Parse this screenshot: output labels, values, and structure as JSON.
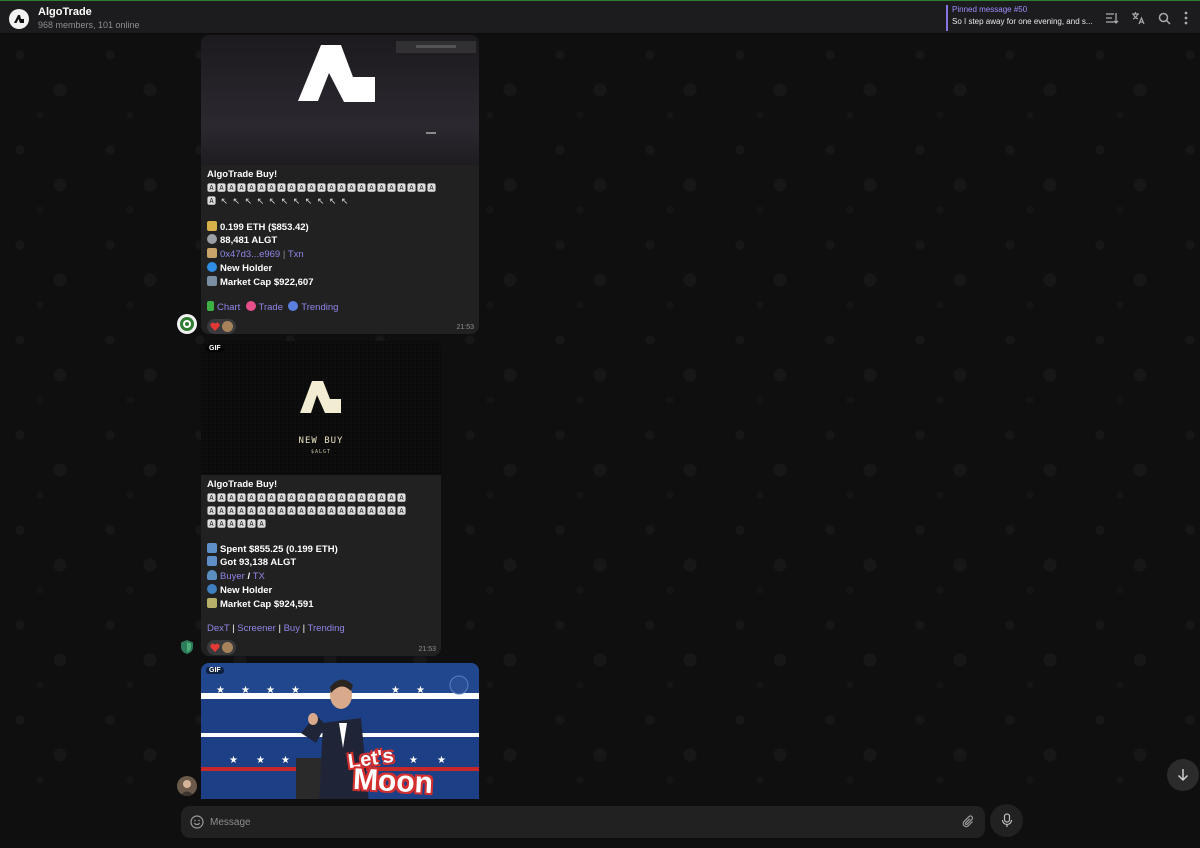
{
  "header": {
    "title": "AlgoTrade",
    "subtitle": "968 members, 101 online",
    "pinned_title": "Pinned message #50",
    "pinned_text": "So I step away for one evening, and s..."
  },
  "messages": [
    {
      "sender": "AlgoTrade Buy!",
      "emoji_line_1": "🅰🅰🅰🅰🅰🅰🅰🅰🅰🅰🅰🅰🅰🅰🅰🅰🅰🅰🅰🅰🅰🅰🅰",
      "emoji_line_2": "🅰 ↖ ↖ ↖ ↖ ↖ ↖ ↖ ↖ ↖ ↖ ↖",
      "line_eth": "0.199 ETH ($853.42)",
      "line_tokens": "88,481 ALGT",
      "address": "0x47d3...e969",
      "separator": "|",
      "txn": "Txn",
      "holder": "New Holder",
      "market_cap": "Market Cap $922,607",
      "links": [
        "Chart",
        "Trade",
        "Trending"
      ],
      "time": "21:53"
    },
    {
      "gif_label": "GIF",
      "gif_title": "NEW BUY",
      "gif_sub": "$ALGT",
      "sender": "AlgoTrade Buy!",
      "emoji_line_1": "🅰🅰🅰🅰🅰🅰🅰🅰🅰🅰🅰🅰🅰🅰🅰🅰🅰🅰🅰🅰",
      "emoji_line_2": "🅰🅰🅰🅰🅰🅰🅰🅰🅰🅰🅰🅰🅰🅰🅰🅰🅰🅰🅰🅰",
      "emoji_line_3": "🅰🅰🅰🅰🅰🅰",
      "spent": "Spent $855.25 (0.199 ETH)",
      "got": "Got 93,138 ALGT",
      "buyer": "Buyer",
      "slash": " / ",
      "tx": "TX",
      "holder": "New Holder",
      "market_cap": "Market Cap $924,591",
      "links": [
        "DexT",
        "Screener",
        "Buy",
        "Trending"
      ],
      "link_sep": " | ",
      "time": "21:53"
    },
    {
      "gif_label": "GIF",
      "caption_1": "Let's",
      "caption_2": "Moon"
    }
  ],
  "composer": {
    "placeholder": "Message"
  },
  "colors": {
    "accent": "#8774e1",
    "link": "#8f86e8",
    "bubble": "#212121",
    "background": "#0f0f0f"
  }
}
